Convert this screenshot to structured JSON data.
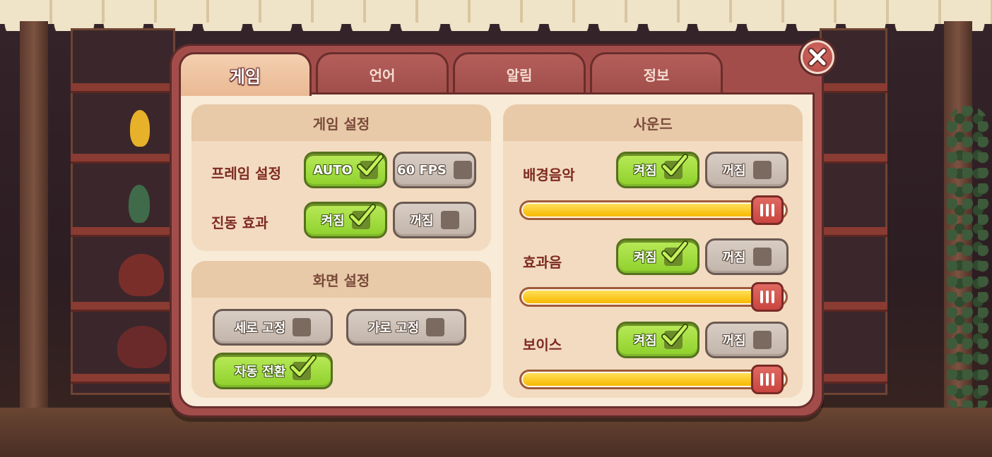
{
  "tabs": [
    {
      "label": "게임",
      "active": true
    },
    {
      "label": "언어",
      "active": false
    },
    {
      "label": "알림",
      "active": false
    },
    {
      "label": "정보",
      "active": false
    }
  ],
  "game_settings": {
    "title": "게임 설정",
    "frame": {
      "label": "프레임 설정",
      "option_a": "AUTO",
      "option_b": "60 FPS",
      "selected": "AUTO"
    },
    "vibration": {
      "label": "진동 효과",
      "on": "켜짐",
      "off": "꺼짐",
      "selected": "켜짐"
    }
  },
  "screen_settings": {
    "title": "화면 설정",
    "portrait": "세로 고정",
    "landscape": "가로 고정",
    "auto_rotate": "자동 전환",
    "selected": "자동 전환"
  },
  "sound": {
    "title": "사운드",
    "bgm": {
      "label": "배경음악",
      "on": "켜짐",
      "off": "꺼짐",
      "selected": "켜짐",
      "level": 1.0
    },
    "sfx": {
      "label": "효과음",
      "on": "켜짐",
      "off": "꺼짐",
      "selected": "켜짐",
      "level": 1.0
    },
    "voice": {
      "label": "보이스",
      "on": "켜짐",
      "off": "꺼짐",
      "selected": "켜짐",
      "level": 1.0
    }
  },
  "icons": {
    "close": "close-x-icon",
    "check": "check-icon",
    "slider_handle": "grip-lines-icon"
  },
  "colors": {
    "on": "#8ed02c",
    "off": "#c2b4aa",
    "dialog": "#a34d4b",
    "accent": "#f7b800"
  }
}
